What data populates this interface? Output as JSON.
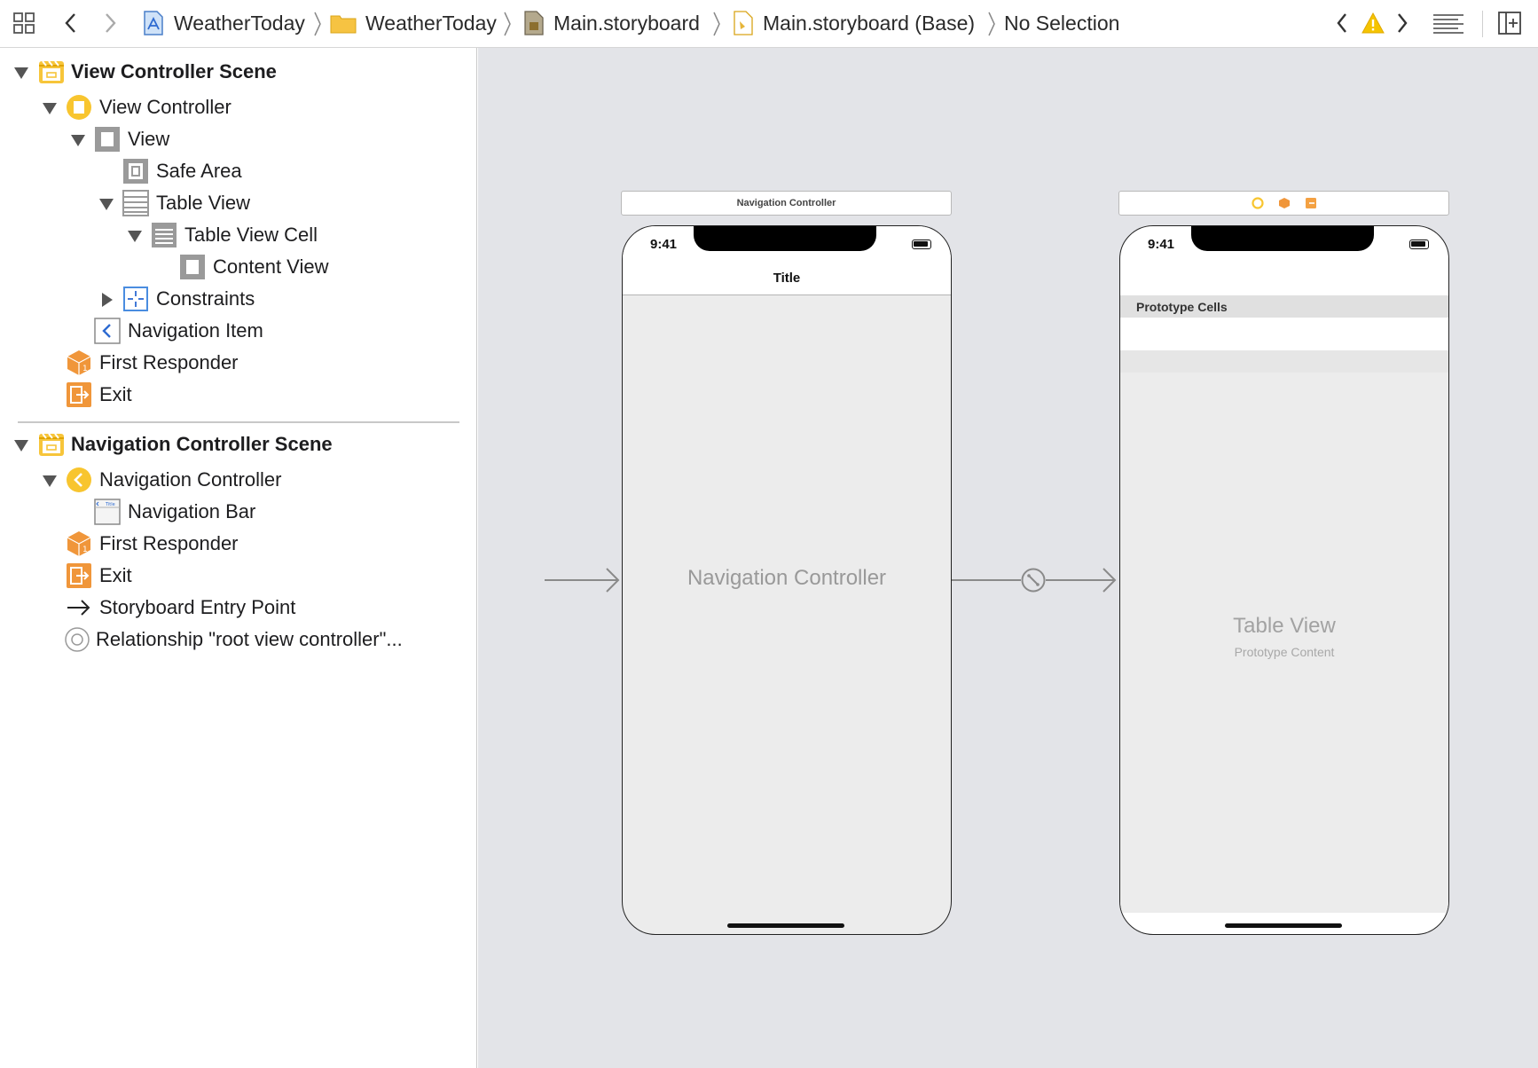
{
  "toolbar": {
    "icons": [
      "related-items-grid-icon",
      "back-chevron-icon",
      "forward-chevron-icon",
      "issue-prev-icon",
      "warning-icon",
      "issue-next-icon",
      "editor-options-icon",
      "add-editor-icon"
    ],
    "breadcrumbs": [
      {
        "label": "WeatherToday",
        "icon": "app-project-icon"
      },
      {
        "label": "WeatherToday",
        "icon": "folder-icon"
      },
      {
        "label": "Main.storyboard",
        "icon": "storyboard-file-icon"
      },
      {
        "label": "Main.storyboard (Base)",
        "icon": "storyboard-base-icon"
      },
      {
        "label": "No Selection",
        "icon": ""
      }
    ],
    "warning_color": "#f5c400"
  },
  "outline": {
    "rows": [
      {
        "label": "View Controller Scene",
        "icon": "scene-icon",
        "disclosure": "open",
        "scene": true
      },
      {
        "label": "View Controller",
        "icon": "view-controller-icon",
        "disclosure": "open"
      },
      {
        "label": "View",
        "icon": "view-icon",
        "disclosure": "open"
      },
      {
        "label": "Safe Area",
        "icon": "safe-area-icon",
        "disclosure": "none"
      },
      {
        "label": "Table View",
        "icon": "table-view-icon",
        "disclosure": "open"
      },
      {
        "label": "Table View Cell",
        "icon": "table-cell-icon",
        "disclosure": "open"
      },
      {
        "label": "Content View",
        "icon": "view-icon",
        "disclosure": "none"
      },
      {
        "label": "Constraints",
        "icon": "constraints-icon",
        "disclosure": "closed"
      },
      {
        "label": "Navigation Item",
        "icon": "navigation-item-icon",
        "disclosure": "none"
      },
      {
        "label": "First Responder",
        "icon": "first-responder-icon",
        "disclosure": "none"
      },
      {
        "label": "Exit",
        "icon": "exit-icon",
        "disclosure": "none"
      },
      {
        "label": "Navigation Controller Scene",
        "icon": "scene-icon",
        "disclosure": "open",
        "scene": true
      },
      {
        "label": "Navigation Controller",
        "icon": "navigation-controller-icon",
        "disclosure": "open"
      },
      {
        "label": "Navigation Bar",
        "icon": "navigation-bar-icon",
        "disclosure": "none"
      },
      {
        "label": "First Responder",
        "icon": "first-responder-icon",
        "disclosure": "none"
      },
      {
        "label": "Exit",
        "icon": "exit-icon",
        "disclosure": "none"
      },
      {
        "label": "Storyboard Entry Point",
        "icon": "entry-arrow-icon",
        "disclosure": "none"
      },
      {
        "label": "Relationship \"root view controller\"...",
        "icon": "relationship-icon",
        "disclosure": "none"
      }
    ],
    "nav_bar_icon_text": "Title"
  },
  "canvas": {
    "background": "#e3e4e8",
    "nav_scene": {
      "bar_label": "Navigation Controller",
      "status_time": "9:41",
      "nav_title": "Title",
      "placeholder": "Navigation Controller"
    },
    "table_scene": {
      "bar_icons": [
        "view-controller-dot-icon",
        "first-responder-dot-icon",
        "exit-dot-icon"
      ],
      "status_time": "9:41",
      "section_header": "Prototype Cells",
      "placeholder_title": "Table View",
      "placeholder_subtitle": "Prototype Content"
    },
    "accent": "#f4a142",
    "controller_yellow": "#f8c52f"
  }
}
